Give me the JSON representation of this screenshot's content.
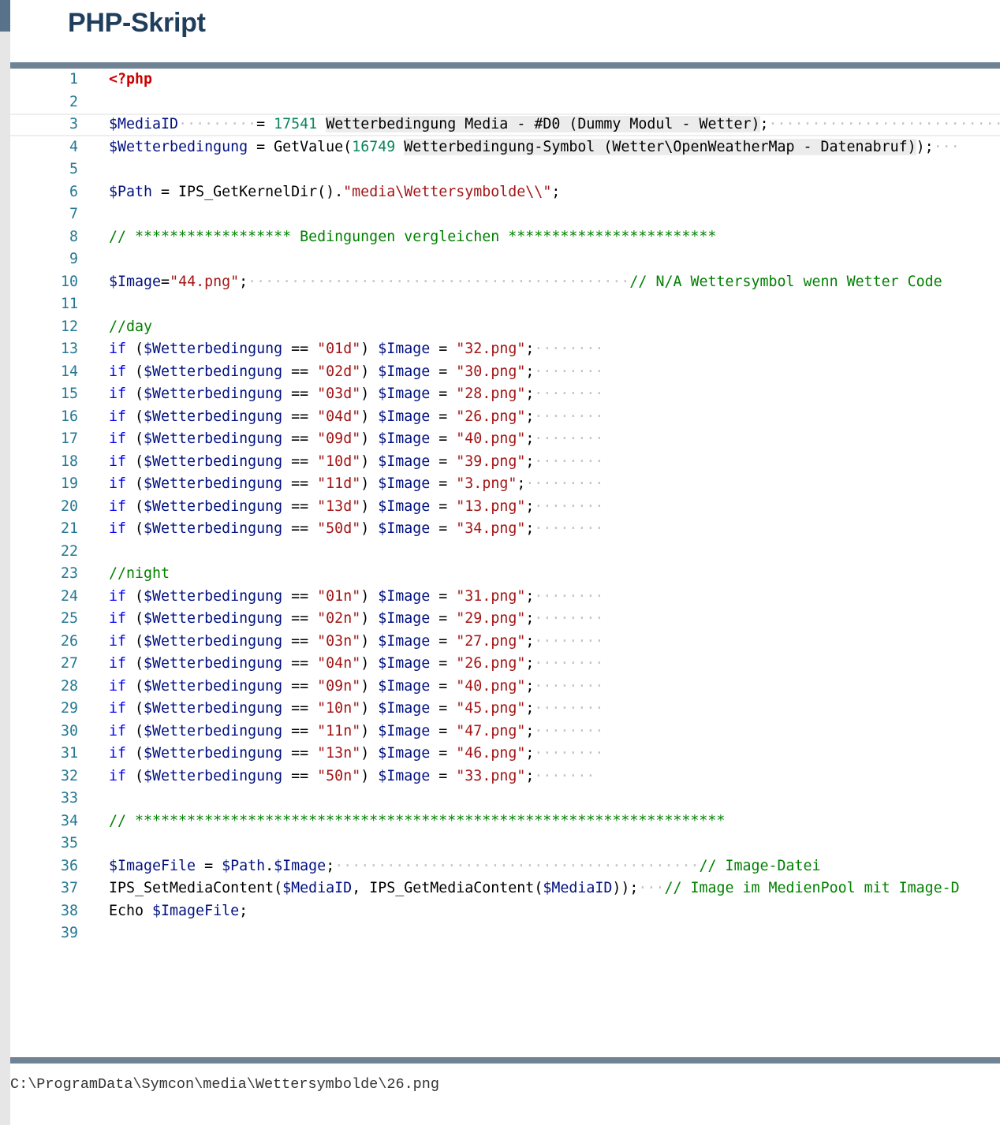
{
  "page": {
    "title": "PHP-Skript"
  },
  "editor": {
    "current_line": 3,
    "lines": [
      [
        {
          "c": "tag",
          "t": "<?php"
        }
      ],
      [],
      [
        {
          "c": "var",
          "t": "$MediaID"
        },
        {
          "c": "dots",
          "t": "·········"
        },
        {
          "t": "= "
        },
        {
          "c": "num",
          "t": "17541"
        },
        {
          "t": " "
        },
        {
          "c": "hl",
          "t": "Wetterbedingung Media - #D0 (Dummy Modul - Wetter)"
        },
        {
          "t": ";"
        },
        {
          "c": "dots",
          "t": "···························"
        }
      ],
      [
        {
          "c": "var",
          "t": "$Wetterbedingung"
        },
        {
          "t": " = GetValue("
        },
        {
          "c": "num",
          "t": "16749"
        },
        {
          "t": " "
        },
        {
          "c": "hl",
          "t": "Wetterbedingung-Symbol (Wetter\\OpenWeatherMap - Datenabruf)"
        },
        {
          "t": ");"
        },
        {
          "c": "dots",
          "t": "···"
        }
      ],
      [],
      [
        {
          "c": "var",
          "t": "$Path"
        },
        {
          "t": " = IPS_GetKernelDir()."
        },
        {
          "c": "str",
          "t": "\"media\\Wettersymbolde\\\\\""
        },
        {
          "t": ";"
        }
      ],
      [],
      [
        {
          "c": "cmt",
          "t": "// ****************** Bedingungen vergleichen ************************"
        }
      ],
      [],
      [
        {
          "c": "var",
          "t": "$Image"
        },
        {
          "t": "="
        },
        {
          "c": "str",
          "t": "\"44.png\""
        },
        {
          "t": ";"
        },
        {
          "c": "dots",
          "t": "············································"
        },
        {
          "c": "cmt",
          "t": "// N/A Wettersymbol wenn Wetter Code"
        }
      ],
      [],
      [
        {
          "c": "cmt",
          "t": "//day"
        }
      ],
      [
        {
          "c": "kw",
          "t": "if"
        },
        {
          "t": " ("
        },
        {
          "c": "var",
          "t": "$Wetterbedingung"
        },
        {
          "t": " == "
        },
        {
          "c": "str",
          "t": "\"01d\""
        },
        {
          "t": ") "
        },
        {
          "c": "var",
          "t": "$Image"
        },
        {
          "t": " = "
        },
        {
          "c": "str",
          "t": "\"32.png\""
        },
        {
          "t": ";"
        },
        {
          "c": "dots",
          "t": "········"
        }
      ],
      [
        {
          "c": "kw",
          "t": "if"
        },
        {
          "t": " ("
        },
        {
          "c": "var",
          "t": "$Wetterbedingung"
        },
        {
          "t": " == "
        },
        {
          "c": "str",
          "t": "\"02d\""
        },
        {
          "t": ") "
        },
        {
          "c": "var",
          "t": "$Image"
        },
        {
          "t": " = "
        },
        {
          "c": "str",
          "t": "\"30.png\""
        },
        {
          "t": ";"
        },
        {
          "c": "dots",
          "t": "········"
        }
      ],
      [
        {
          "c": "kw",
          "t": "if"
        },
        {
          "t": " ("
        },
        {
          "c": "var",
          "t": "$Wetterbedingung"
        },
        {
          "t": " == "
        },
        {
          "c": "str",
          "t": "\"03d\""
        },
        {
          "t": ") "
        },
        {
          "c": "var",
          "t": "$Image"
        },
        {
          "t": " = "
        },
        {
          "c": "str",
          "t": "\"28.png\""
        },
        {
          "t": ";"
        },
        {
          "c": "dots",
          "t": "········"
        }
      ],
      [
        {
          "c": "kw",
          "t": "if"
        },
        {
          "t": " ("
        },
        {
          "c": "var",
          "t": "$Wetterbedingung"
        },
        {
          "t": " == "
        },
        {
          "c": "str",
          "t": "\"04d\""
        },
        {
          "t": ") "
        },
        {
          "c": "var",
          "t": "$Image"
        },
        {
          "t": " = "
        },
        {
          "c": "str",
          "t": "\"26.png\""
        },
        {
          "t": ";"
        },
        {
          "c": "dots",
          "t": "········"
        }
      ],
      [
        {
          "c": "kw",
          "t": "if"
        },
        {
          "t": " ("
        },
        {
          "c": "var",
          "t": "$Wetterbedingung"
        },
        {
          "t": " == "
        },
        {
          "c": "str",
          "t": "\"09d\""
        },
        {
          "t": ") "
        },
        {
          "c": "var",
          "t": "$Image"
        },
        {
          "t": " = "
        },
        {
          "c": "str",
          "t": "\"40.png\""
        },
        {
          "t": ";"
        },
        {
          "c": "dots",
          "t": "········"
        }
      ],
      [
        {
          "c": "kw",
          "t": "if"
        },
        {
          "t": " ("
        },
        {
          "c": "var",
          "t": "$Wetterbedingung"
        },
        {
          "t": " == "
        },
        {
          "c": "str",
          "t": "\"10d\""
        },
        {
          "t": ") "
        },
        {
          "c": "var",
          "t": "$Image"
        },
        {
          "t": " = "
        },
        {
          "c": "str",
          "t": "\"39.png\""
        },
        {
          "t": ";"
        },
        {
          "c": "dots",
          "t": "········"
        }
      ],
      [
        {
          "c": "kw",
          "t": "if"
        },
        {
          "t": " ("
        },
        {
          "c": "var",
          "t": "$Wetterbedingung"
        },
        {
          "t": " == "
        },
        {
          "c": "str",
          "t": "\"11d\""
        },
        {
          "t": ") "
        },
        {
          "c": "var",
          "t": "$Image"
        },
        {
          "t": " = "
        },
        {
          "c": "str",
          "t": "\"3.png\""
        },
        {
          "t": ";"
        },
        {
          "c": "dots",
          "t": "·········"
        }
      ],
      [
        {
          "c": "kw",
          "t": "if"
        },
        {
          "t": " ("
        },
        {
          "c": "var",
          "t": "$Wetterbedingung"
        },
        {
          "t": " == "
        },
        {
          "c": "str",
          "t": "\"13d\""
        },
        {
          "t": ") "
        },
        {
          "c": "var",
          "t": "$Image"
        },
        {
          "t": " = "
        },
        {
          "c": "str",
          "t": "\"13.png\""
        },
        {
          "t": ";"
        },
        {
          "c": "dots",
          "t": "········"
        }
      ],
      [
        {
          "c": "kw",
          "t": "if"
        },
        {
          "t": " ("
        },
        {
          "c": "var",
          "t": "$Wetterbedingung"
        },
        {
          "t": " == "
        },
        {
          "c": "str",
          "t": "\"50d\""
        },
        {
          "t": ") "
        },
        {
          "c": "var",
          "t": "$Image"
        },
        {
          "t": " = "
        },
        {
          "c": "str",
          "t": "\"34.png\""
        },
        {
          "t": ";"
        },
        {
          "c": "dots",
          "t": "········"
        }
      ],
      [],
      [
        {
          "c": "cmt",
          "t": "//night"
        }
      ],
      [
        {
          "c": "kw",
          "t": "if"
        },
        {
          "t": " ("
        },
        {
          "c": "var",
          "t": "$Wetterbedingung"
        },
        {
          "t": " == "
        },
        {
          "c": "str",
          "t": "\"01n\""
        },
        {
          "t": ") "
        },
        {
          "c": "var",
          "t": "$Image"
        },
        {
          "t": " = "
        },
        {
          "c": "str",
          "t": "\"31.png\""
        },
        {
          "t": ";"
        },
        {
          "c": "dots",
          "t": "········"
        }
      ],
      [
        {
          "c": "kw",
          "t": "if"
        },
        {
          "t": " ("
        },
        {
          "c": "var",
          "t": "$Wetterbedingung"
        },
        {
          "t": " == "
        },
        {
          "c": "str",
          "t": "\"02n\""
        },
        {
          "t": ") "
        },
        {
          "c": "var",
          "t": "$Image"
        },
        {
          "t": " = "
        },
        {
          "c": "str",
          "t": "\"29.png\""
        },
        {
          "t": ";"
        },
        {
          "c": "dots",
          "t": "········"
        }
      ],
      [
        {
          "c": "kw",
          "t": "if"
        },
        {
          "t": " ("
        },
        {
          "c": "var",
          "t": "$Wetterbedingung"
        },
        {
          "t": " == "
        },
        {
          "c": "str",
          "t": "\"03n\""
        },
        {
          "t": ") "
        },
        {
          "c": "var",
          "t": "$Image"
        },
        {
          "t": " = "
        },
        {
          "c": "str",
          "t": "\"27.png\""
        },
        {
          "t": ";"
        },
        {
          "c": "dots",
          "t": "········"
        }
      ],
      [
        {
          "c": "kw",
          "t": "if"
        },
        {
          "t": " ("
        },
        {
          "c": "var",
          "t": "$Wetterbedingung"
        },
        {
          "t": " == "
        },
        {
          "c": "str",
          "t": "\"04n\""
        },
        {
          "t": ") "
        },
        {
          "c": "var",
          "t": "$Image"
        },
        {
          "t": " = "
        },
        {
          "c": "str",
          "t": "\"26.png\""
        },
        {
          "t": ";"
        },
        {
          "c": "dots",
          "t": "········"
        }
      ],
      [
        {
          "c": "kw",
          "t": "if"
        },
        {
          "t": " ("
        },
        {
          "c": "var",
          "t": "$Wetterbedingung"
        },
        {
          "t": " == "
        },
        {
          "c": "str",
          "t": "\"09n\""
        },
        {
          "t": ") "
        },
        {
          "c": "var",
          "t": "$Image"
        },
        {
          "t": " = "
        },
        {
          "c": "str",
          "t": "\"40.png\""
        },
        {
          "t": ";"
        },
        {
          "c": "dots",
          "t": "········"
        }
      ],
      [
        {
          "c": "kw",
          "t": "if"
        },
        {
          "t": " ("
        },
        {
          "c": "var",
          "t": "$Wetterbedingung"
        },
        {
          "t": " == "
        },
        {
          "c": "str",
          "t": "\"10n\""
        },
        {
          "t": ") "
        },
        {
          "c": "var",
          "t": "$Image"
        },
        {
          "t": " = "
        },
        {
          "c": "str",
          "t": "\"45.png\""
        },
        {
          "t": ";"
        },
        {
          "c": "dots",
          "t": "········"
        }
      ],
      [
        {
          "c": "kw",
          "t": "if"
        },
        {
          "t": " ("
        },
        {
          "c": "var",
          "t": "$Wetterbedingung"
        },
        {
          "t": " == "
        },
        {
          "c": "str",
          "t": "\"11n\""
        },
        {
          "t": ") "
        },
        {
          "c": "var",
          "t": "$Image"
        },
        {
          "t": " = "
        },
        {
          "c": "str",
          "t": "\"47.png\""
        },
        {
          "t": ";"
        },
        {
          "c": "dots",
          "t": "········"
        }
      ],
      [
        {
          "c": "kw",
          "t": "if"
        },
        {
          "t": " ("
        },
        {
          "c": "var",
          "t": "$Wetterbedingung"
        },
        {
          "t": " == "
        },
        {
          "c": "str",
          "t": "\"13n\""
        },
        {
          "t": ") "
        },
        {
          "c": "var",
          "t": "$Image"
        },
        {
          "t": " = "
        },
        {
          "c": "str",
          "t": "\"46.png\""
        },
        {
          "t": ";"
        },
        {
          "c": "dots",
          "t": "········"
        }
      ],
      [
        {
          "c": "kw",
          "t": "if"
        },
        {
          "t": " ("
        },
        {
          "c": "var",
          "t": "$Wetterbedingung"
        },
        {
          "t": " == "
        },
        {
          "c": "str",
          "t": "\"50n\""
        },
        {
          "t": ") "
        },
        {
          "c": "var",
          "t": "$Image"
        },
        {
          "t": " = "
        },
        {
          "c": "str",
          "t": "\"33.png\""
        },
        {
          "t": ";"
        },
        {
          "c": "dots",
          "t": "·······"
        }
      ],
      [],
      [
        {
          "c": "cmt",
          "t": "// ********************************************************************"
        }
      ],
      [],
      [
        {
          "c": "var",
          "t": "$ImageFile"
        },
        {
          "t": " = "
        },
        {
          "c": "var",
          "t": "$Path"
        },
        {
          "t": "."
        },
        {
          "c": "var",
          "t": "$Image"
        },
        {
          "t": ";"
        },
        {
          "c": "dots",
          "t": "··········································"
        },
        {
          "c": "cmt",
          "t": "// Image-Datei"
        }
      ],
      [
        {
          "t": "IPS_SetMediaContent("
        },
        {
          "c": "var",
          "t": "$MediaID"
        },
        {
          "t": ", IPS_GetMediaContent("
        },
        {
          "c": "var",
          "t": "$MediaID"
        },
        {
          "t": "));"
        },
        {
          "c": "dots",
          "t": "···"
        },
        {
          "c": "cmt",
          "t": "// Image im MedienPool mit Image-D"
        }
      ],
      [
        {
          "t": "Echo "
        },
        {
          "c": "var",
          "t": "$ImageFile"
        },
        {
          "t": ";"
        }
      ],
      []
    ]
  },
  "output": {
    "text": "C:\\ProgramData\\Symcon\\media\\Wettersymbolde\\26.png"
  },
  "colors": {
    "title": "#1f3e5c",
    "rule": "#6f8395",
    "line_number": "#237893",
    "keyword": "#0000ff",
    "variable": "#001080",
    "string": "#a31515",
    "number": "#098658",
    "comment": "#008000",
    "php_tag": "#cc0000"
  }
}
